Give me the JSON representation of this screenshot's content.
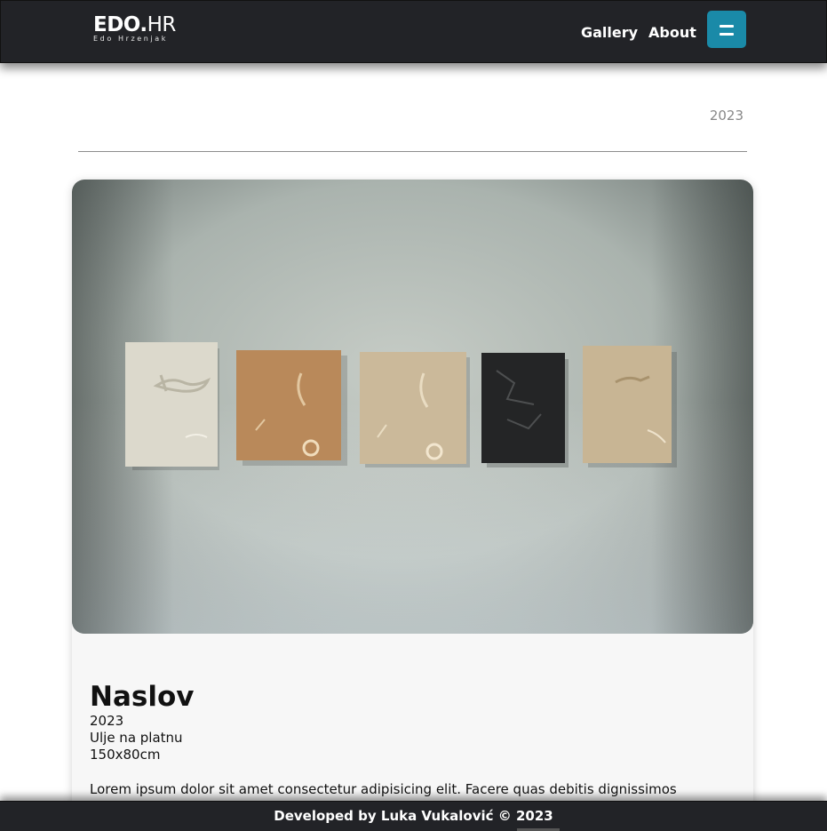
{
  "header": {
    "brand_title_bold": "EDO.",
    "brand_title_light": "HR",
    "brand_subtitle": "Edo Hrzenjak",
    "nav": [
      "Gallery",
      "About"
    ],
    "menu_icon": "hamburger-menu-icon"
  },
  "page": {
    "year": "2023"
  },
  "artwork": {
    "title": "Naslov",
    "year": "2023",
    "technique": "Ulje na platnu",
    "size": "150x80cm",
    "description": "Lorem ipsum dolor sit amet consectetur adipisicing elit. Facere quas debitis dignissimos"
  },
  "footer": {
    "text": "Developed by Luka Vukalović © 2023"
  },
  "colors": {
    "topbar": "#222327",
    "accent": "#1a8aa8",
    "card": "#f7f7f7"
  }
}
